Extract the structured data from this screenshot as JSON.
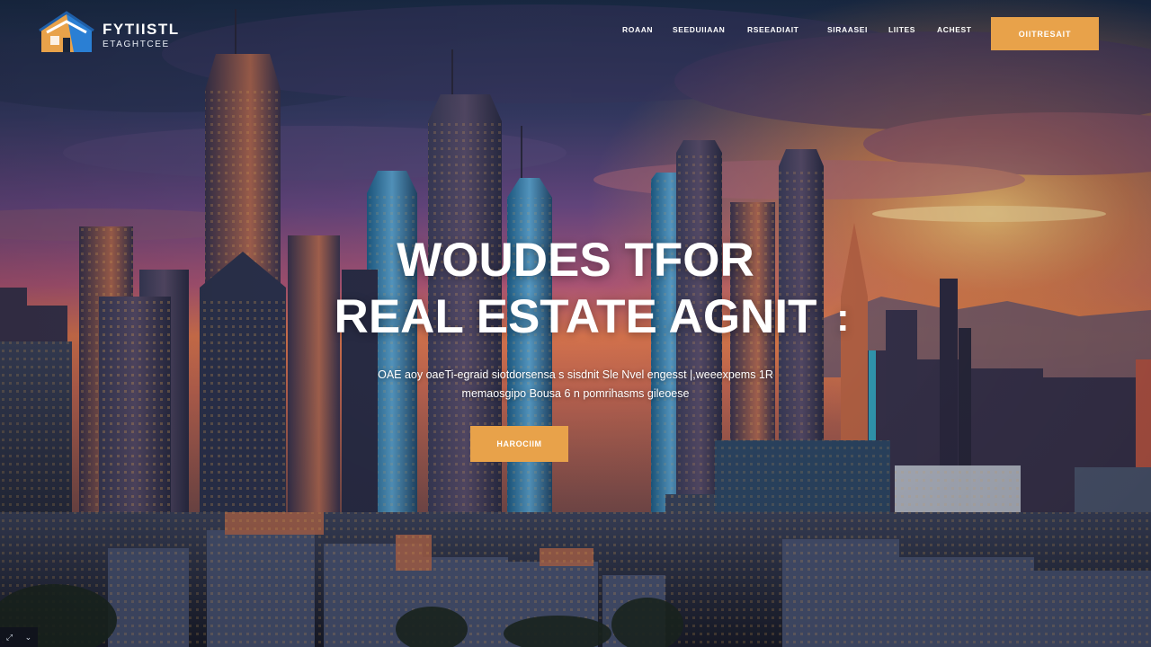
{
  "brand": {
    "name_line1": "FYTIISTL",
    "name_line2": "ETAGHTCEE",
    "logo_icon": "house-logo-icon"
  },
  "nav": {
    "items": [
      {
        "label": "ROAAN"
      },
      {
        "label": "SEEDUIIAAN"
      },
      {
        "label": "RSEEADIAIT"
      },
      {
        "label": "SIRAASEI"
      },
      {
        "label": "LIITES"
      },
      {
        "label": "ACHEST"
      }
    ],
    "cta_label": "OIITRESAIT"
  },
  "hero": {
    "title_line1": "WOUDES TFOR",
    "title_line2": "REAL ESTATE AGNIT",
    "title_mark": ":",
    "subtitle_line1": "OAE  aoy  oaeTi-egraid siotdorsensa  s  sisdnit Sle Nvel engesst |,weeexpems 1R",
    "subtitle_line2": "memaosgipo Bousa 6 n pomrihasms gileoese",
    "cta_label": "HAROCIIM"
  },
  "colors": {
    "accent": "#e8a24a",
    "text": "#ffffff",
    "sky_top": "#1f3350",
    "sky_mid": "#6a4a86",
    "sky_sunset": "#f08a3a"
  },
  "corner_widget": {
    "icon_left": "expand-icon",
    "icon_right": "chevron-down-icon",
    "left_glyph": "⤢",
    "right_glyph": "⌄"
  }
}
